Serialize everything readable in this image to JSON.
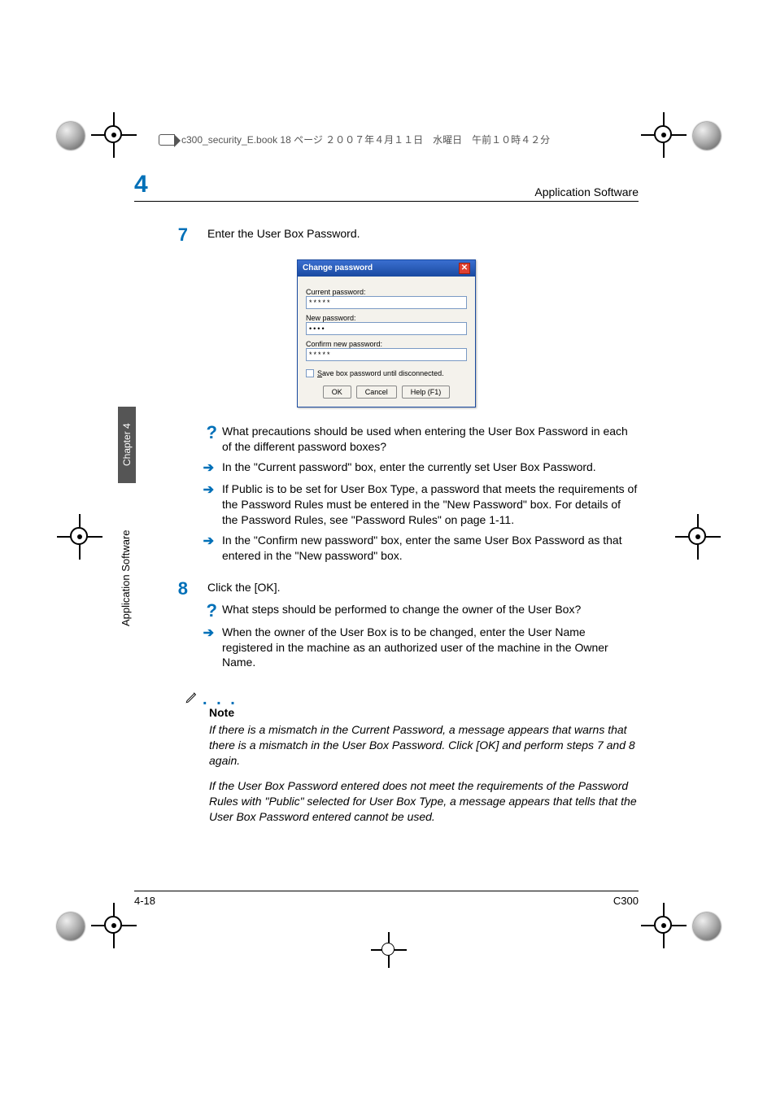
{
  "book_header": "c300_security_E.book  18 ページ  ２００７年４月１１日　水曜日　午前１０時４２分",
  "running_head": {
    "chapter_num": "4",
    "title": "Application Software"
  },
  "side": {
    "tab": "Chapter 4",
    "label": "Application Software"
  },
  "steps": {
    "s7": {
      "num": "7",
      "text": "Enter the User Box Password.",
      "q": "What precautions should be used when entering the User Box Password in each of the different password boxes?",
      "a1": "In the \"Current password\" box, enter the currently set User Box Password.",
      "a2": "If Public is to be set for User Box Type, a password that meets the requirements of the Password Rules must be entered in the \"New Password\" box. For details of the Password Rules, see \"Password Rules\" on page 1-11.",
      "a3": "In the \"Confirm new password\" box, enter the same User Box Password as that entered in the \"New password\" box."
    },
    "s8": {
      "num": "8",
      "text": "Click the [OK].",
      "q": "What steps should be performed to change the owner of the User Box?",
      "a1": "When the owner of the User Box is to be changed, enter the User Name registered in the machine as an authorized user of the machine in the Owner Name."
    }
  },
  "dialog": {
    "title": "Change password",
    "current_label": "Current password:",
    "current_value": "*****",
    "new_label": "New password:",
    "new_value": "••••",
    "confirm_label": "Confirm new password:",
    "confirm_value": "*****",
    "save_underline": "S",
    "save_text": "ave box password until disconnected.",
    "ok": "OK",
    "cancel": "Cancel",
    "help": "Help (F1)"
  },
  "note": {
    "label": "Note",
    "p1": "If there is a mismatch in the Current Password, a message appears that warns that there is a mismatch in the User Box Password. Click [OK] and perform steps 7 and 8 again.",
    "p2": "If the User Box Password entered does not meet the requirements of the Password Rules with \"Public\" selected for User Box Type, a message appears that tells that the User Box Password entered cannot be used."
  },
  "footer": {
    "page": "4-18",
    "model": "C300"
  }
}
